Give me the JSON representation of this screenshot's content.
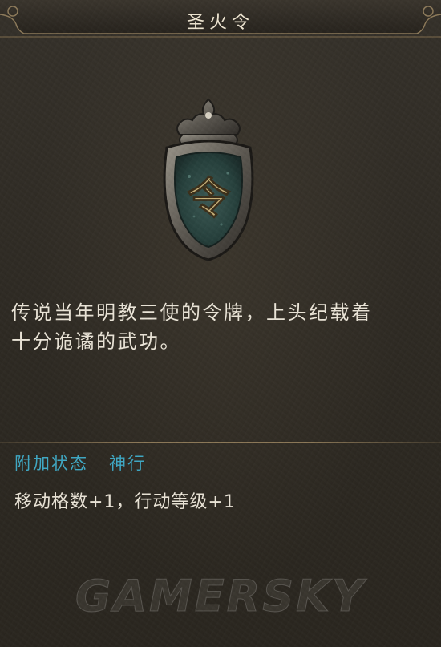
{
  "item": {
    "name": "圣火令",
    "description_line1": "传说当年明教三使的令牌，上头纪载着",
    "description_line2": "十分诡谲的武功。",
    "glyph": "令",
    "icon": "token-plaque-icon"
  },
  "attributes": {
    "label": "附加状态",
    "value": "神行",
    "effect": "移动格数+1，行动等级+1"
  },
  "watermark": "GAMERSKY",
  "colors": {
    "attribute_text": "#3fa8c4",
    "body_text": "#ebe5d8",
    "title_text": "#efe6d2",
    "background": "#2f2b24",
    "divider": "#aa9168"
  }
}
